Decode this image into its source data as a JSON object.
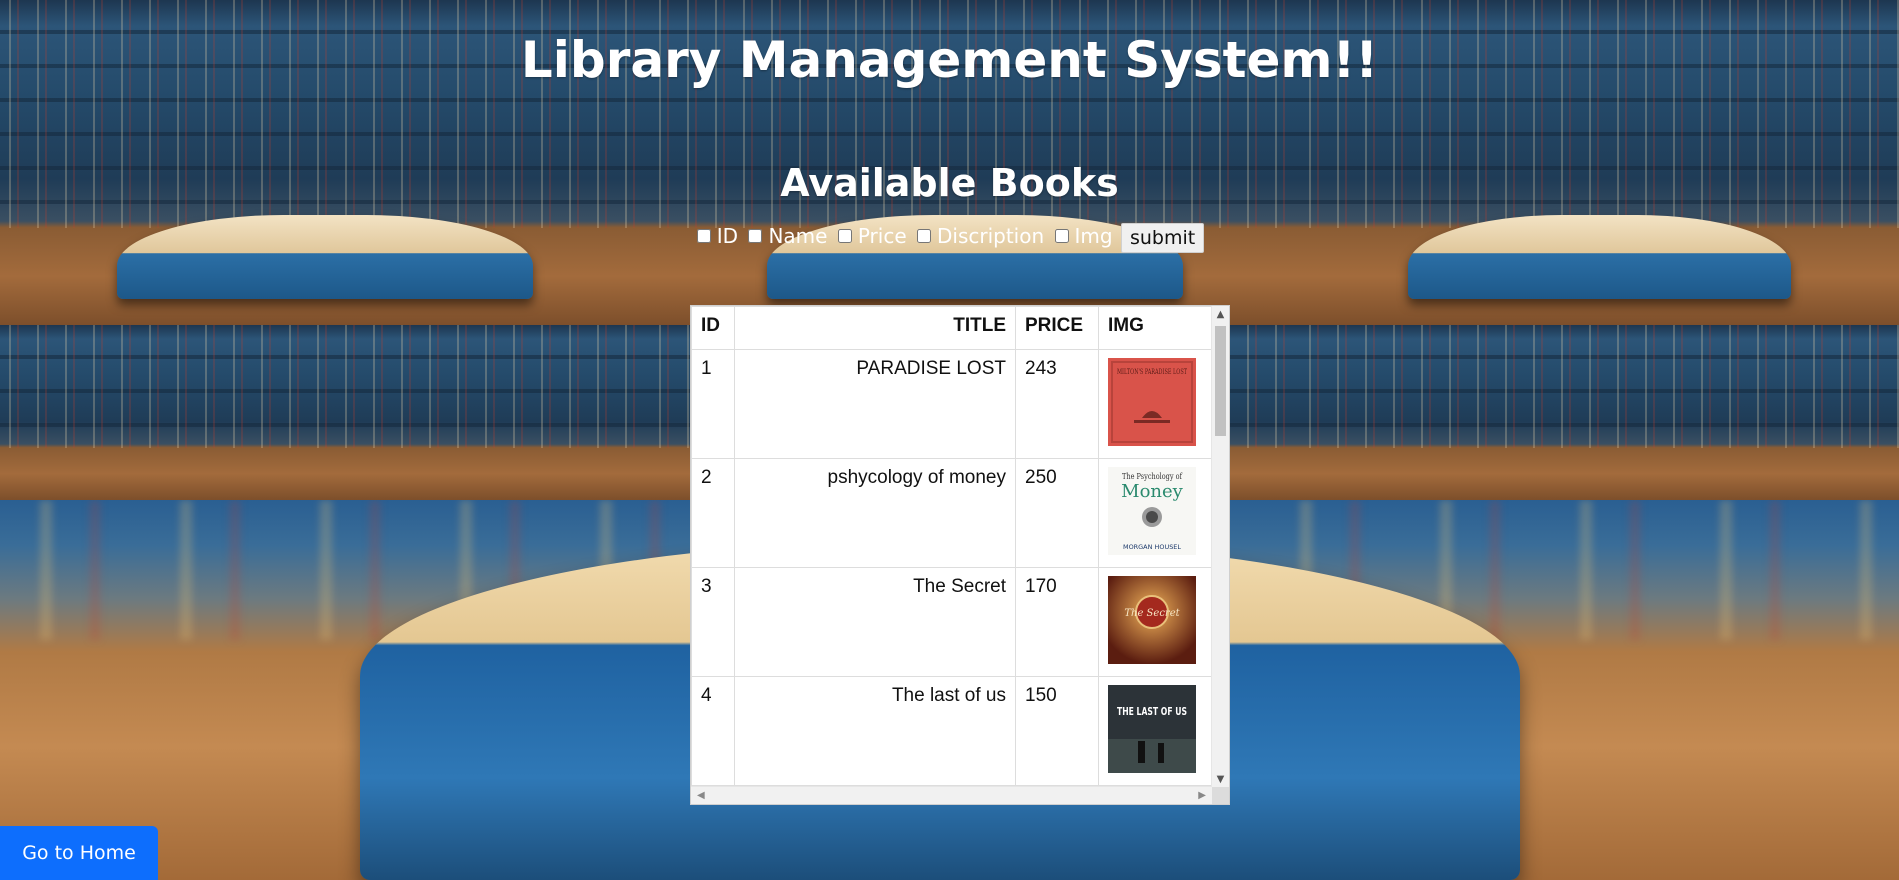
{
  "header": {
    "title": "Library Management System!!",
    "subtitle": "Available Books"
  },
  "filters": {
    "options": [
      "ID",
      "Name",
      "Price",
      "Discription",
      "Img"
    ],
    "submit_label": "submit"
  },
  "table": {
    "columns": [
      "ID",
      "TITLE",
      "PRICE",
      "IMG"
    ],
    "rows": [
      {
        "id": "1",
        "title": "PARADISE LOST",
        "price": "243",
        "img": "paradise-lost-cover"
      },
      {
        "id": "2",
        "title": "pshycology of money",
        "price": "250",
        "img": "psychology-of-money-cover"
      },
      {
        "id": "3",
        "title": "The Secret",
        "price": "170",
        "img": "the-secret-cover"
      },
      {
        "id": "4",
        "title": "The last of us",
        "price": "150",
        "img": "the-last-of-us-cover"
      }
    ]
  },
  "cover_texts": {
    "paradise_lost": "MILTON'S PARADISE LOST",
    "psychology_top": "The Psychology of",
    "psychology_main": "Money",
    "psychology_author": "MORGAN HOUSEL",
    "secret": "The Secret",
    "lastofus": "THE LAST OF US"
  },
  "footer": {
    "home_label": "Go to Home"
  },
  "colors": {
    "primary_button": "#0d6efd",
    "title_text": "#ffffff"
  }
}
